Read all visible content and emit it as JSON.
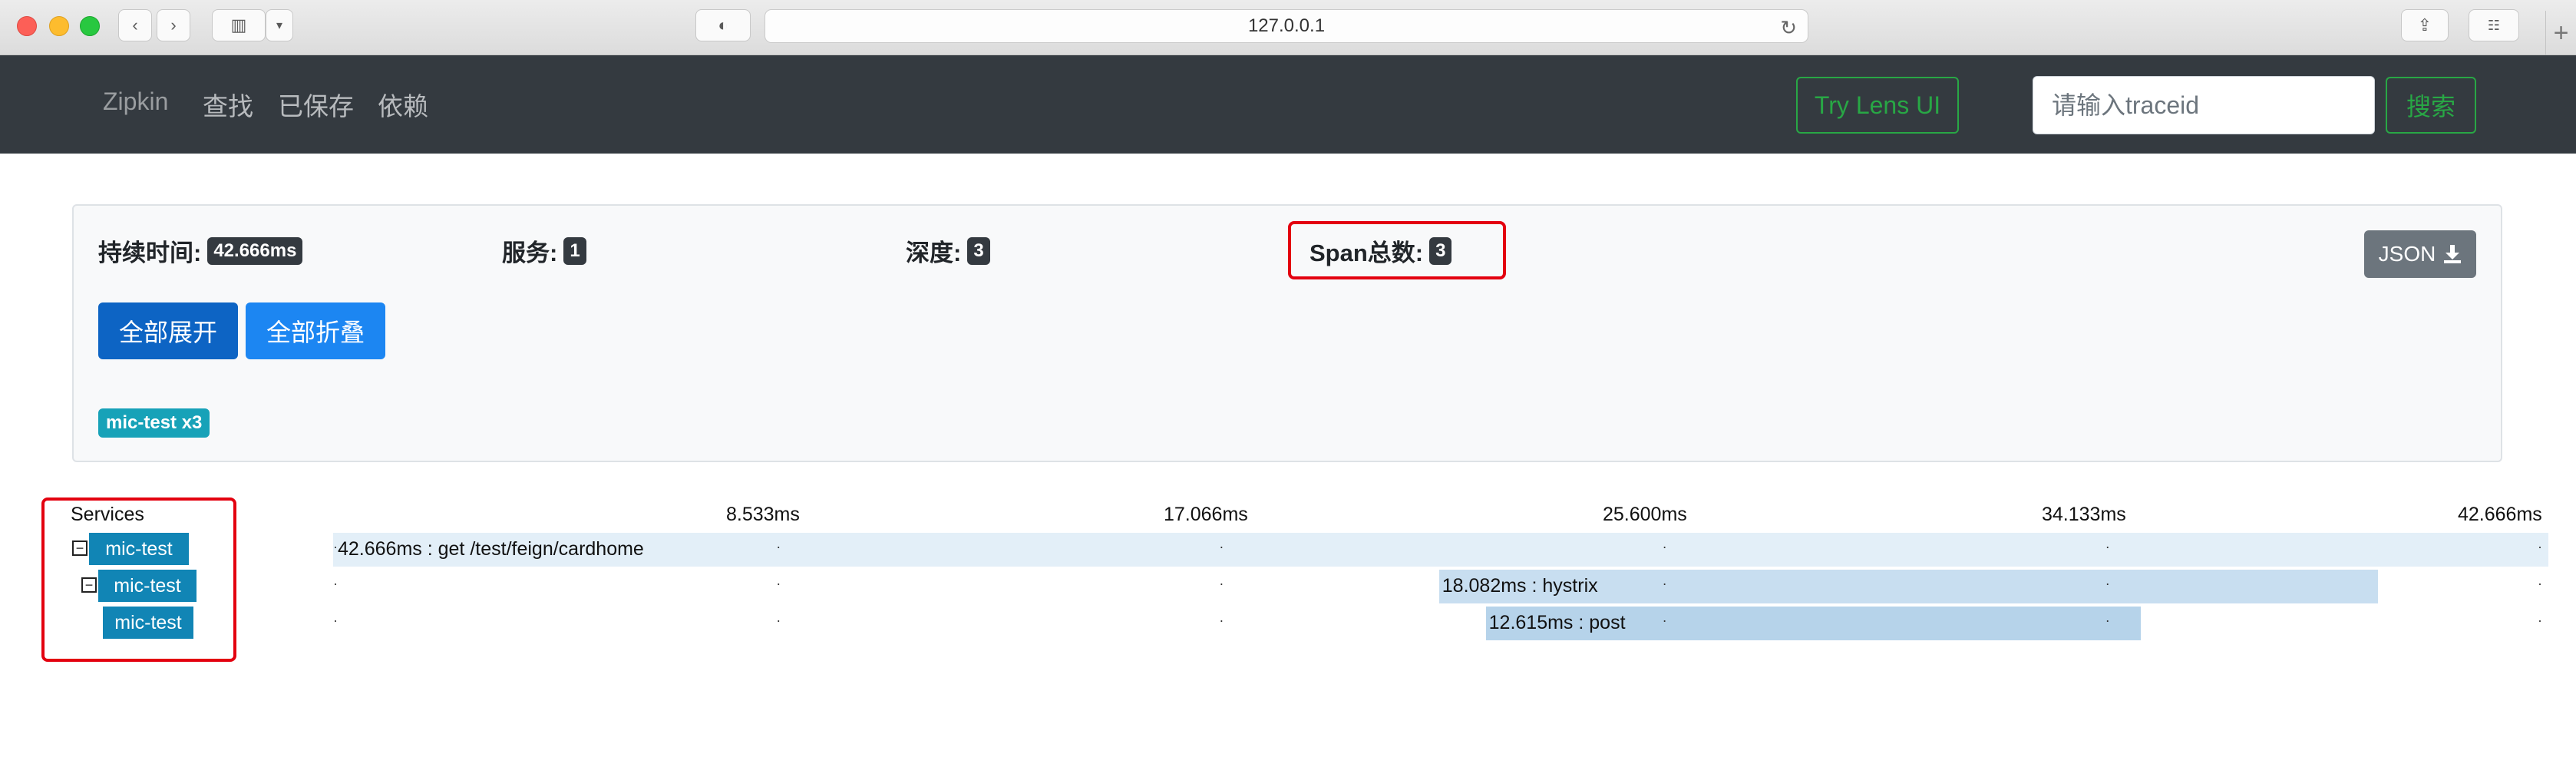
{
  "browser": {
    "url": "127.0.0.1"
  },
  "navbar": {
    "brand": "Zipkin",
    "links": [
      "查找",
      "已保存",
      "依赖"
    ],
    "lens_button": "Try Lens UI",
    "traceid_placeholder": "请输入traceid",
    "search_button": "搜索"
  },
  "summary": {
    "duration_label": "持续时间:",
    "duration_value": "42.666ms",
    "services_label": "服务:",
    "services_value": "1",
    "depth_label": "深度:",
    "depth_value": "3",
    "span_count_label": "Span总数:",
    "span_count_value": "3",
    "json_button": "JSON",
    "expand_all": "全部展开",
    "collapse_all": "全部折叠",
    "service_badge": "mic-test x3"
  },
  "timeline": {
    "services_header": "Services",
    "ticks": [
      "8.533ms",
      "17.066ms",
      "25.600ms",
      "34.133ms",
      "42.666ms"
    ],
    "spans": [
      {
        "service": "mic-test",
        "label": "42.666ms : get /test/feign/cardhome",
        "start_ms": 0,
        "duration_ms": 42.666,
        "depth": 0
      },
      {
        "service": "mic-test",
        "label": "18.082ms : hystrix",
        "start_ms": 21.3,
        "duration_ms": 18.082,
        "depth": 1
      },
      {
        "service": "mic-test",
        "label": "12.615ms : post",
        "start_ms": 22.2,
        "duration_ms": 12.615,
        "depth": 2
      }
    ],
    "colors": {
      "span_light": "#e3eff8",
      "span_mid": "#c8def0",
      "span_dark": "#b6d3ea",
      "service": "#1185b5",
      "highlight": "#e3000f"
    }
  }
}
